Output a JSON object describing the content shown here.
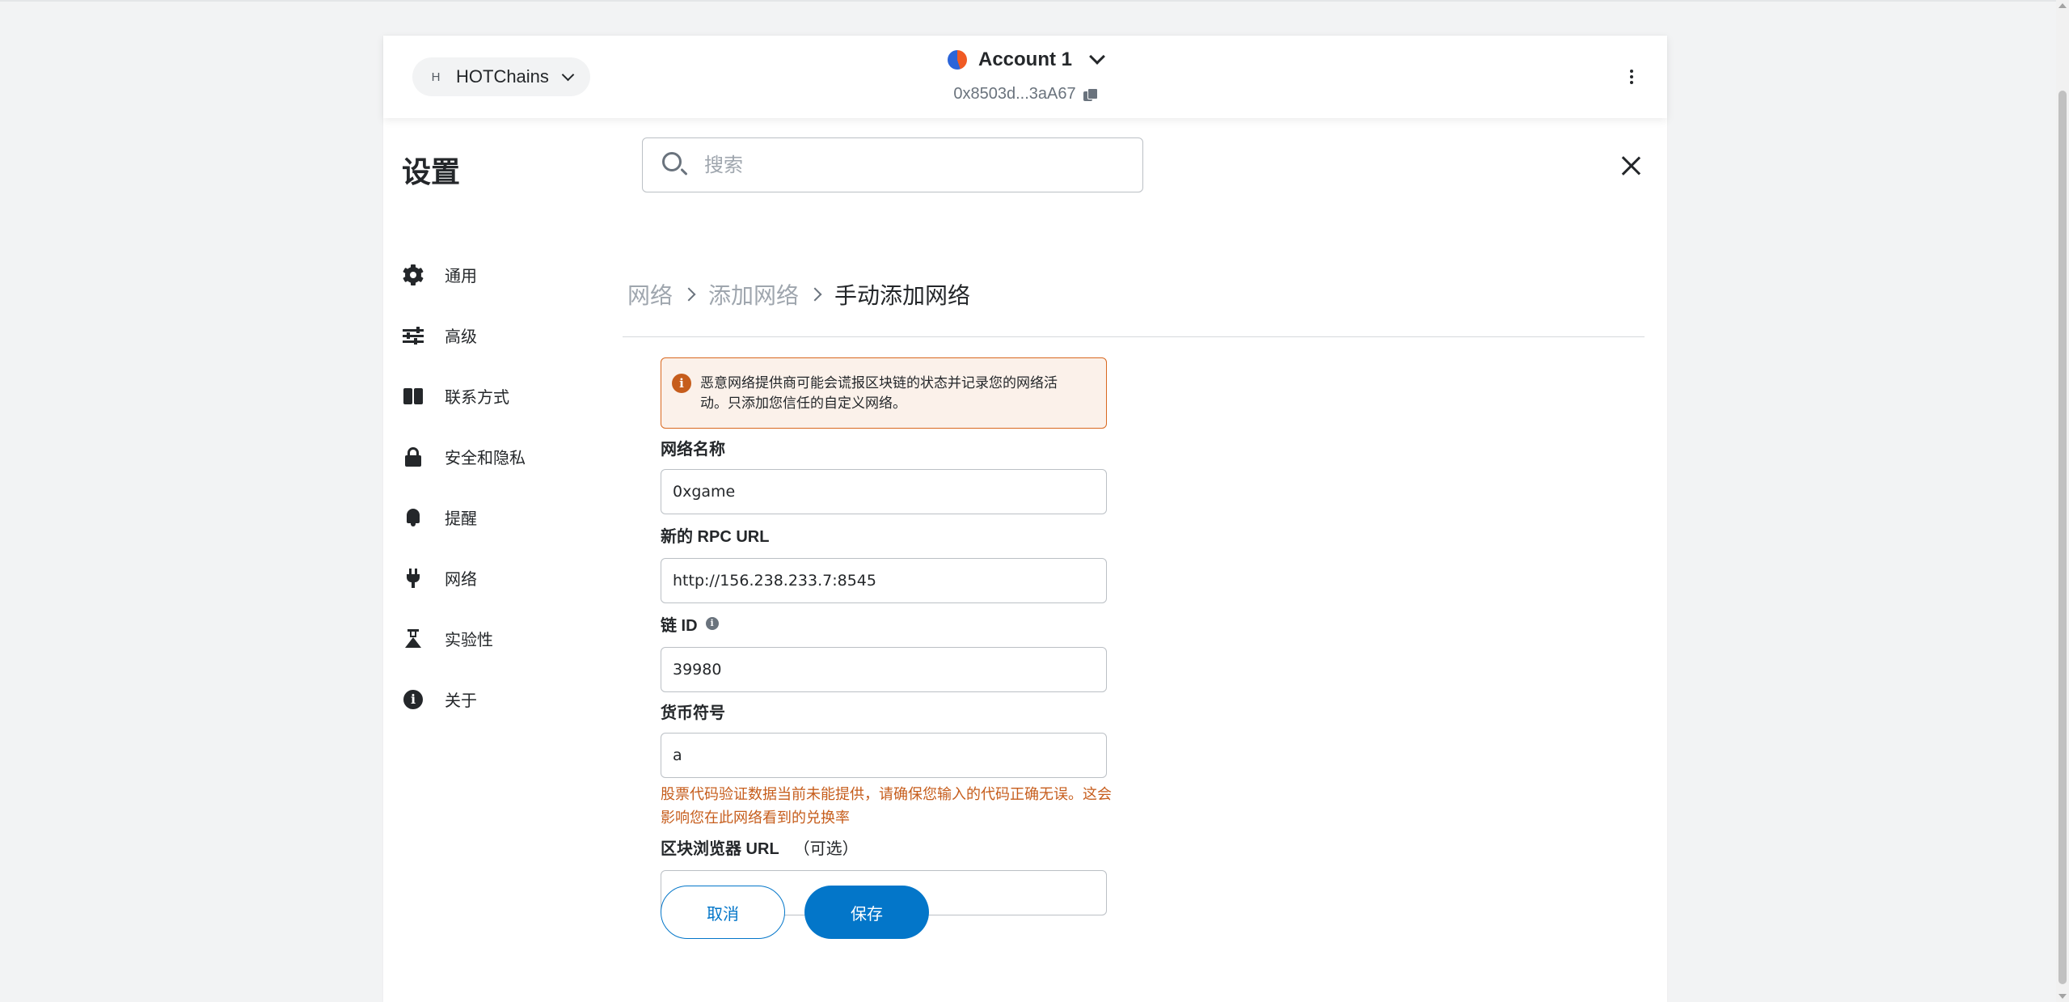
{
  "header": {
    "network": {
      "avatar_letter": "H",
      "name": "HOTChains"
    },
    "account": {
      "name": "Account 1",
      "address": "0x8503d...3aA67"
    }
  },
  "settings": {
    "title": "设置",
    "search_placeholder": "搜索"
  },
  "sidebar": {
    "items": [
      {
        "label": "通用",
        "icon": "gear-icon"
      },
      {
        "label": "高级",
        "icon": "sliders-icon"
      },
      {
        "label": "联系方式",
        "icon": "book-icon"
      },
      {
        "label": "安全和隐私",
        "icon": "lock-icon"
      },
      {
        "label": "提醒",
        "icon": "bell-icon"
      },
      {
        "label": "网络",
        "icon": "plug-icon"
      },
      {
        "label": "实验性",
        "icon": "flask-icon"
      },
      {
        "label": "关于",
        "icon": "info-icon"
      }
    ]
  },
  "breadcrumb": {
    "items": [
      "网络",
      "添加网络"
    ],
    "current": "手动添加网络"
  },
  "form": {
    "warning": "恶意网络提供商可能会谎报区块链的状态并记录您的网络活动。只添加您信任的自定义网络。",
    "network_name": {
      "label": "网络名称",
      "value": "0xgame"
    },
    "rpc_url": {
      "label": "新的 RPC URL",
      "value": "http://156.238.233.7:8545"
    },
    "chain_id": {
      "label": "链 ID",
      "value": "39980"
    },
    "currency_symbol": {
      "label": "货币符号",
      "value": "a"
    },
    "currency_error": "股票代码验证数据当前未能提供，请确保您输入的代码正确无误。这会影响您在此网络看到的兑换率",
    "explorer_url": {
      "label": "区块浏览器 URL",
      "optional": "（可选）",
      "value": ""
    },
    "cancel_label": "取消",
    "save_label": "保存"
  },
  "colors": {
    "primary": "#0376c9",
    "warning": "#c65d1c",
    "warning_bg": "#fbf1ea"
  }
}
